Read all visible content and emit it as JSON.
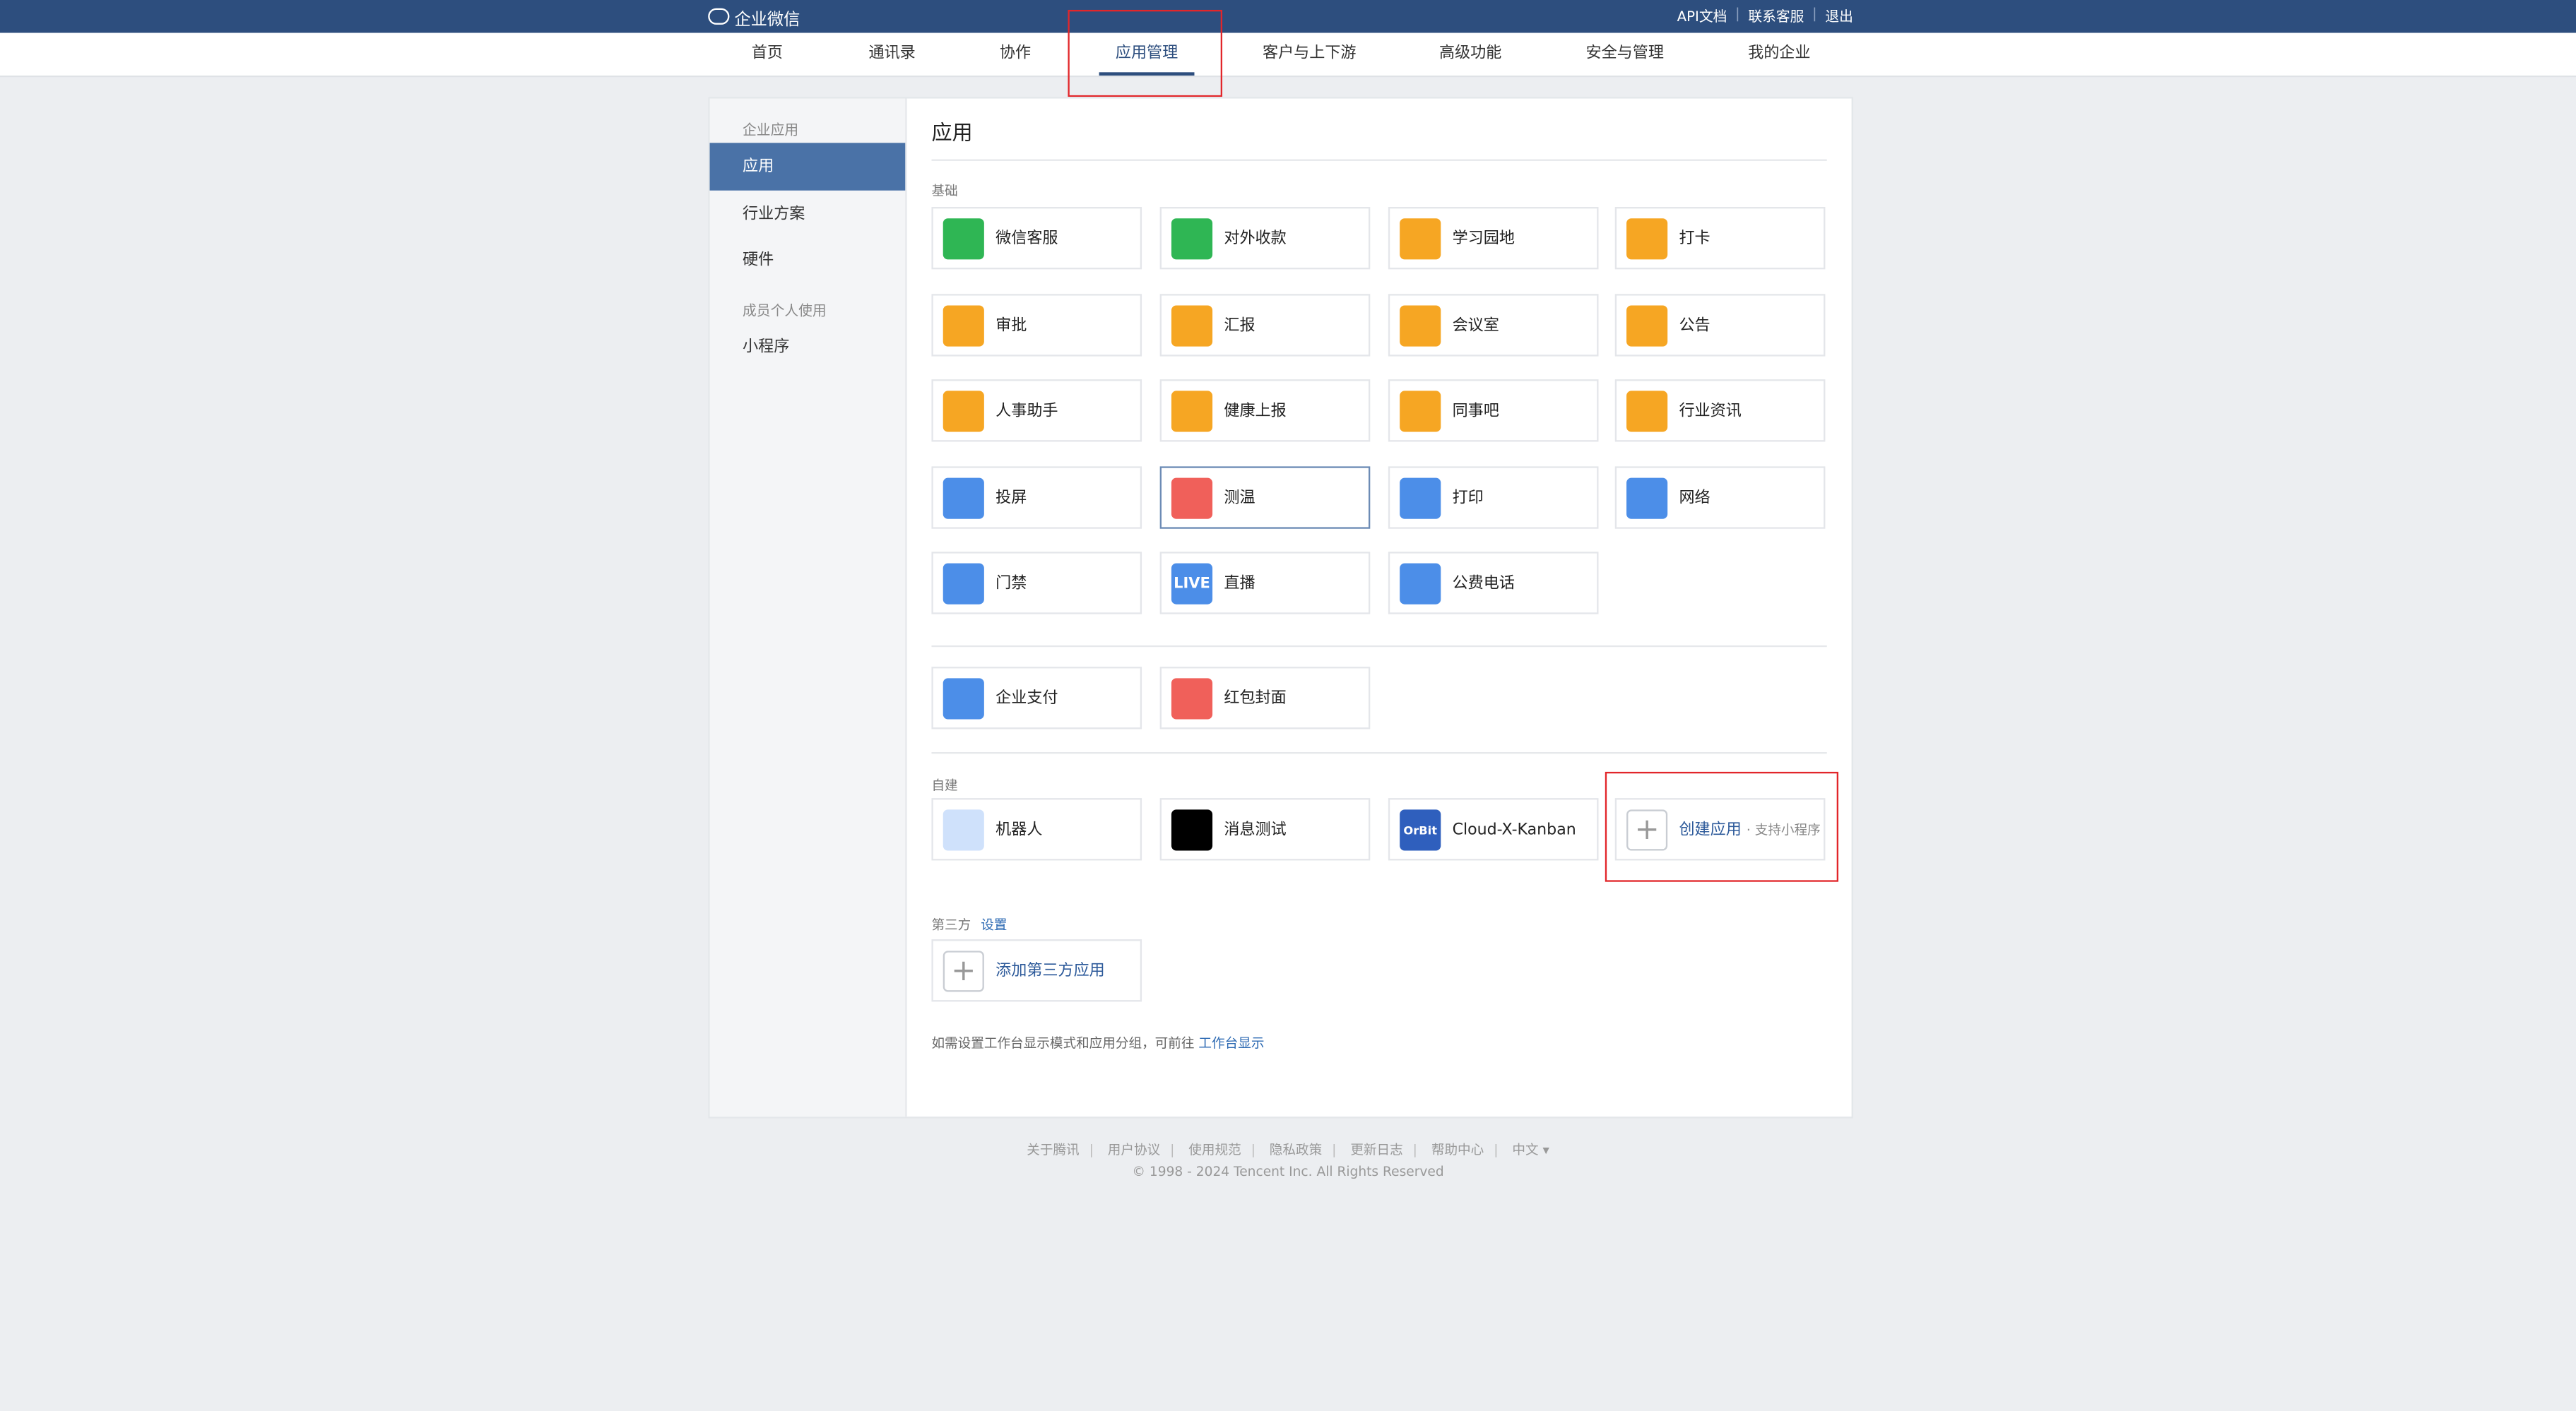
{
  "topbar": {
    "logo_text": "企业微信",
    "links": [
      "API文档",
      "联系客服",
      "退出"
    ]
  },
  "nav": {
    "tabs": [
      {
        "label": "首页"
      },
      {
        "label": "通讯录"
      },
      {
        "label": "协作"
      },
      {
        "label": "应用管理",
        "active": true
      },
      {
        "label": "客户与上下游"
      },
      {
        "label": "高级功能"
      },
      {
        "label": "安全与管理"
      },
      {
        "label": "我的企业"
      }
    ]
  },
  "sidebar": {
    "caption1": "企业应用",
    "items": [
      {
        "label": "应用",
        "active": true
      },
      {
        "label": "行业方案"
      },
      {
        "label": "硬件"
      }
    ],
    "caption2": "成员个人使用",
    "items2": [
      {
        "label": "小程序"
      }
    ]
  },
  "main": {
    "title": "应用",
    "basic_label": "基础",
    "basic_apps": [
      {
        "label": "微信客服",
        "icon": "chat-bubble-icon",
        "color": "#2fb654"
      },
      {
        "label": "对外收款",
        "icon": "yuan-icon",
        "color": "#2fb654"
      },
      {
        "label": "学习园地",
        "icon": "planet-icon",
        "color": "#f6a623"
      },
      {
        "label": "打卡",
        "icon": "location-pin-icon",
        "color": "#f6a623"
      },
      {
        "label": "审批",
        "icon": "stamp-icon",
        "color": "#f6a623"
      },
      {
        "label": "汇报",
        "icon": "report-icon",
        "color": "#f6a623"
      },
      {
        "label": "会议室",
        "icon": "door-icon",
        "color": "#f6a623"
      },
      {
        "label": "公告",
        "icon": "megaphone-icon",
        "color": "#f6a623"
      },
      {
        "label": "人事助手",
        "icon": "person-icon",
        "color": "#f6a623"
      },
      {
        "label": "健康上报",
        "icon": "health-icon",
        "color": "#f6a623"
      },
      {
        "label": "同事吧",
        "icon": "nodes-icon",
        "color": "#f6a623"
      },
      {
        "label": "行业资讯",
        "icon": "news-icon",
        "color": "#f6a623"
      },
      {
        "label": "投屏",
        "icon": "screen-cast-icon",
        "color": "#4c8ee8"
      },
      {
        "label": "测温",
        "icon": "thermometer-icon",
        "color": "#f0605a",
        "highlighted": true
      },
      {
        "label": "打印",
        "icon": "printer-icon",
        "color": "#4c8ee8"
      },
      {
        "label": "网络",
        "icon": "router-icon",
        "color": "#4c8ee8"
      },
      {
        "label": "门禁",
        "icon": "door-access-icon",
        "color": "#4c8ee8"
      },
      {
        "label": "直播",
        "icon": "live-icon",
        "color": "#4c8ee8",
        "icon_text": "LIVE"
      },
      {
        "label": "公费电话",
        "icon": "phone-icon",
        "color": "#4c8ee8"
      }
    ],
    "pay_apps": [
      {
        "label": "企业支付",
        "icon": "pay-icon",
        "color": "#4c8ee8"
      },
      {
        "label": "红包封面",
        "icon": "red-envelope-icon",
        "color": "#f0605a"
      }
    ],
    "custom_label": "自建",
    "custom_apps": [
      {
        "label": "机器人",
        "icon": "robot-icon",
        "color": "#cfe1fb"
      },
      {
        "label": "消息测试",
        "icon": "black-square-icon",
        "color": "#000000"
      },
      {
        "label": "Cloud-X-Kanban",
        "icon": "orbit-logo-icon",
        "color": "#2f5fbd",
        "icon_text": "OrBit"
      }
    ],
    "create_app": {
      "label": "创建应用",
      "sub": "· 支持小程序"
    },
    "third_label": "第三方",
    "third_settings": "设置",
    "add_third": "添加第三方应用",
    "tip_text": "如需设置工作台显示模式和应用分组，可前往",
    "tip_link": "工作台显示"
  },
  "footer": {
    "links": [
      "关于腾讯",
      "用户协议",
      "使用规范",
      "隐私政策",
      "更新日志",
      "帮助中心",
      "中文 ▾"
    ],
    "copyright": "© 1998 - 2024 Tencent Inc. All Rights Reserved"
  }
}
